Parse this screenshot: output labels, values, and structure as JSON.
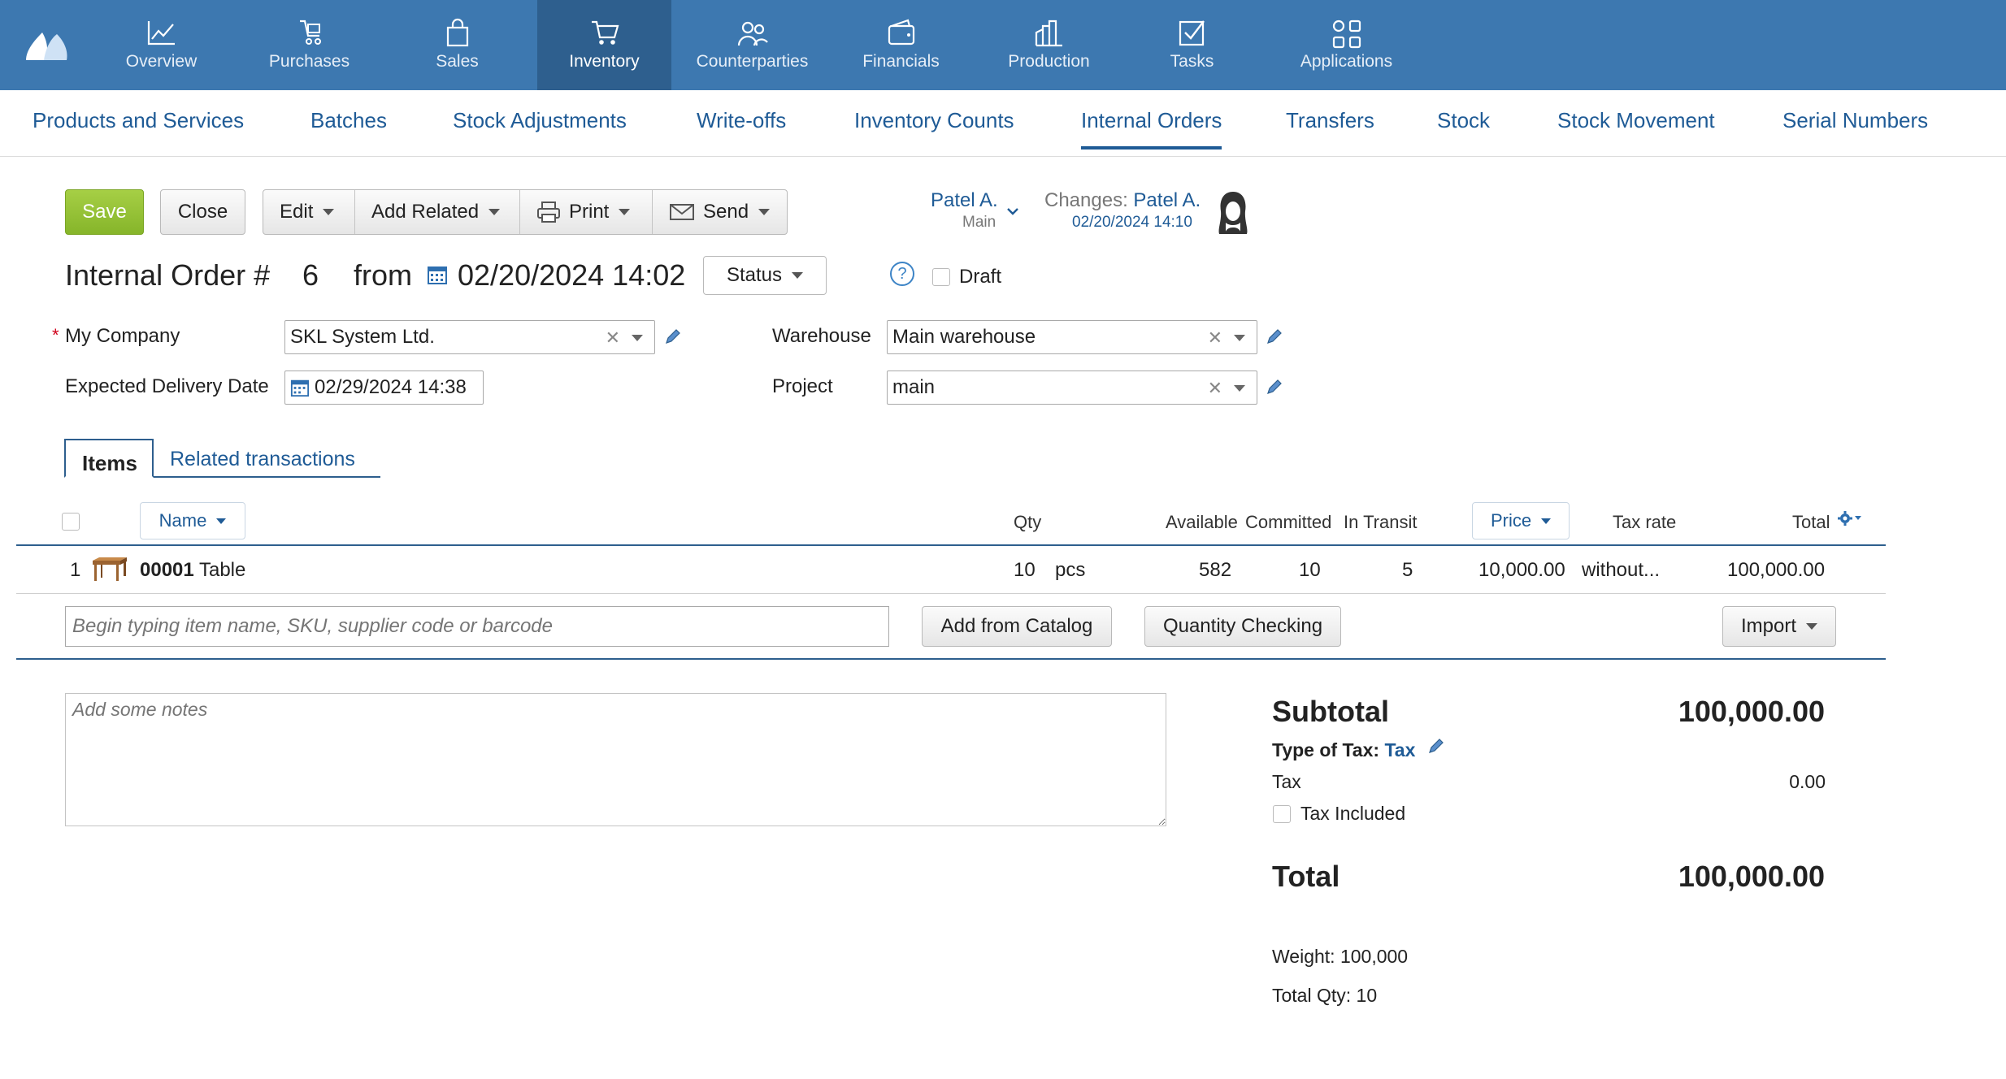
{
  "topnav": {
    "items": [
      {
        "label": "Overview",
        "icon": "chart-line-icon"
      },
      {
        "label": "Purchases",
        "icon": "purchases-icon"
      },
      {
        "label": "Sales",
        "icon": "shopping-bag-icon"
      },
      {
        "label": "Inventory",
        "icon": "cart-icon",
        "active": true
      },
      {
        "label": "Counterparties",
        "icon": "people-icon"
      },
      {
        "label": "Financials",
        "icon": "wallet-icon"
      },
      {
        "label": "Production",
        "icon": "factory-icon"
      },
      {
        "label": "Tasks",
        "icon": "checkbox-icon"
      },
      {
        "label": "Applications",
        "icon": "apps-grid-icon"
      }
    ]
  },
  "subnav": {
    "items": [
      "Products and Services",
      "Batches",
      "Stock Adjustments",
      "Write-offs",
      "Inventory Counts",
      "Internal Orders",
      "Transfers",
      "Stock",
      "Stock Movement",
      "Serial Numbers"
    ],
    "active": "Internal Orders"
  },
  "toolbar": {
    "save": "Save",
    "close": "Close",
    "edit": "Edit",
    "add_related": "Add Related",
    "print": "Print",
    "send": "Send"
  },
  "owner": {
    "name": "Patel A.",
    "sub": "Main"
  },
  "changes": {
    "label": "Changes:",
    "name": "Patel A.",
    "date": "02/20/2024 14:10"
  },
  "doc": {
    "title": "Internal Order #",
    "number": "6",
    "from": "from",
    "date": "02/20/2024 14:02",
    "status": "Status",
    "draft": "Draft",
    "help": "?"
  },
  "form": {
    "my_company_label": "My Company",
    "my_company_value": "SKL System Ltd.",
    "required_mark": "*",
    "delivery_label": "Expected Delivery Date",
    "delivery_value": "02/29/2024 14:38",
    "warehouse_label": "Warehouse",
    "warehouse_value": "Main warehouse",
    "project_label": "Project",
    "project_value": "main"
  },
  "tabs": {
    "items": "Items",
    "related": "Related transactions"
  },
  "table": {
    "headers": {
      "name": "Name",
      "qty": "Qty",
      "available": "Available",
      "committed": "Committed",
      "in_transit": "In Transit",
      "price": "Price",
      "tax_rate": "Tax rate",
      "total": "Total"
    },
    "rows": [
      {
        "num": "1",
        "sku": "00001",
        "name": "Table",
        "qty": "10",
        "unit": "pcs",
        "available": "582",
        "committed": "10",
        "in_transit": "5",
        "price": "10,000.00",
        "tax_rate": "without...",
        "total": "100,000.00"
      }
    ]
  },
  "add_item": {
    "placeholder": "Begin typing item name, SKU, supplier code or barcode",
    "catalog": "Add from Catalog",
    "qty_check": "Quantity Checking",
    "import": "Import"
  },
  "notes": {
    "placeholder": "Add some notes"
  },
  "summary": {
    "subtotal_label": "Subtotal",
    "subtotal_value": "100,000.00",
    "type_of_tax_label": "Type of Tax:",
    "type_of_tax_value": "Tax",
    "tax_label": "Tax",
    "tax_value": "0.00",
    "tax_included": "Tax Included",
    "total_label": "Total",
    "total_value": "100,000.00",
    "weight": "Weight: 100,000",
    "total_qty": "Total Qty: 10"
  },
  "colors": {
    "nav_bg": "#3d78b0",
    "nav_active": "#2e5f8e",
    "link": "#1f5b96",
    "save_green": "#94c23a"
  }
}
